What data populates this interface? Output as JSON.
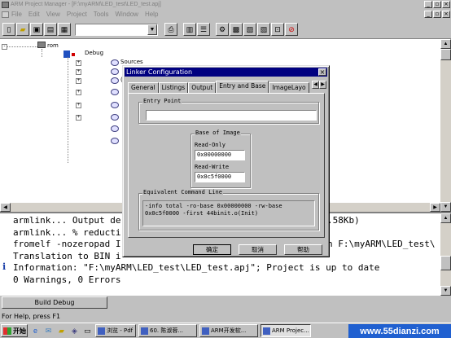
{
  "window": {
    "title": "ARM Project Manager - [F:\\myARM\\LED_test\\LED_test.apj]"
  },
  "menubar": {
    "items": [
      "File",
      "Edit",
      "View",
      "Project",
      "Tools",
      "Window",
      "Help"
    ]
  },
  "tree": {
    "root": "rom",
    "child": "Debug",
    "first_folder": "Sources",
    "partial_label": "(",
    "folder_count": 8
  },
  "output": {
    "lines": [
      {
        "prefix": "",
        "text": "armlink... Output de"
      },
      {
        "prefix": "",
        "text": "armlink... % reducti"
      },
      {
        "prefix": "",
        "text": "fromelf -nozeropad I"
      },
      {
        "prefix": "",
        "text": "Translation to BIN i"
      },
      {
        "prefix": "i",
        "text": "Information:  \"F:\\myARM\\LED_test\\LED_test.apj\";  Project is up to date"
      },
      {
        "prefix": "",
        "text": "0 Warnings, 0 Errors"
      }
    ],
    "right_fragments": {
      "line1": ".58Kb)",
      "line3": "n F:\\myARM\\LED_test\\"
    }
  },
  "build_tab": {
    "label": "Build Debug"
  },
  "statusbar": {
    "text": "For Help, press F1"
  },
  "taskbar": {
    "start_label": "开始",
    "tasks": [
      {
        "label": "浏览 - Pdf"
      },
      {
        "label": "60. 陈淑蓉..."
      },
      {
        "label": "ARM开发软..."
      },
      {
        "label": "ARM Projec..."
      }
    ],
    "tray_text": "www.55dianzi.com"
  },
  "dialog": {
    "title": "Linker Configuration",
    "tabs": [
      "General",
      "Listings",
      "Output",
      "Entry and Base",
      "ImageLayo"
    ],
    "selected_tab": "Entry and Base",
    "entry_point": {
      "label": "Entry Point",
      "value": ""
    },
    "base_of_image": {
      "label": "Base of Image",
      "read_only_label": "Read-Only",
      "read_only_value": "0x00000000",
      "read_write_label": "Read-Write",
      "read_write_value": "0x0c5f0000"
    },
    "equivalent": {
      "label": "Equivalent Command Line",
      "text_line1": "-info total -ro-base 0x00000000 -rw-base",
      "text_line2": "0x0c5f0000 -first 44binit.o(Init)"
    },
    "buttons": {
      "ok": "确定",
      "cancel": "取消",
      "help": "帮助"
    }
  }
}
